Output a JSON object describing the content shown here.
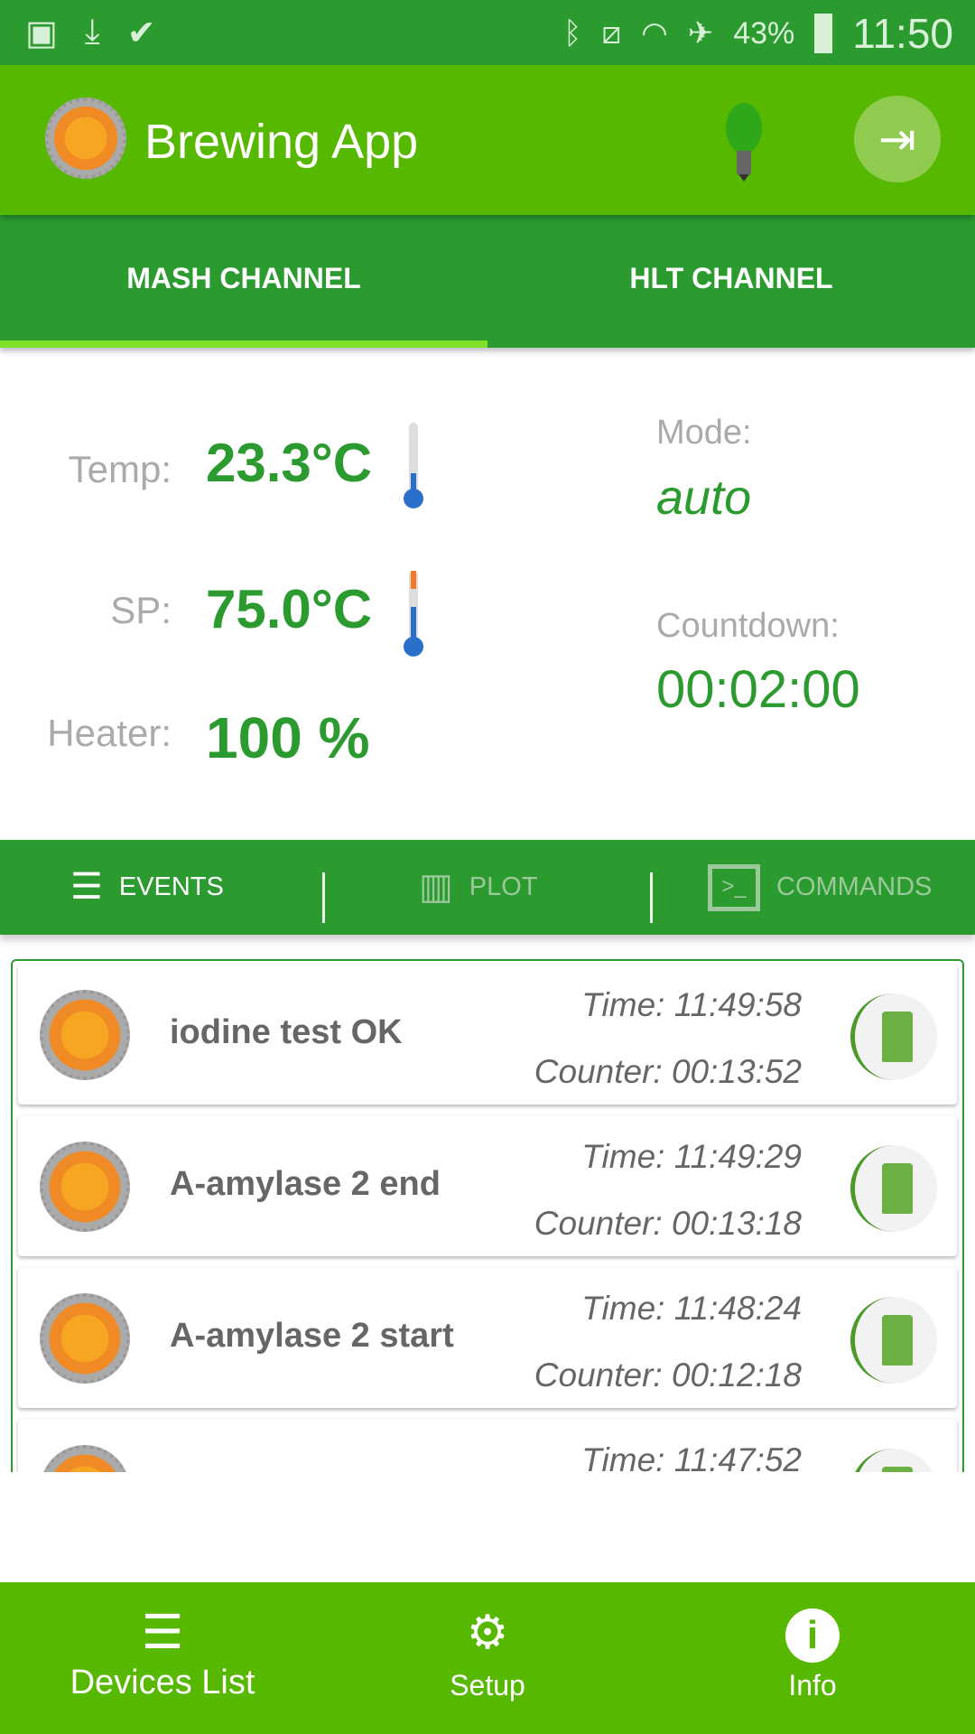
{
  "status_bar": {
    "battery": "43%",
    "time": "11:50",
    "icons": [
      "image-icon",
      "download-icon",
      "check-icon",
      "bluetooth-icon",
      "vibrate-icon",
      "wifi-icon",
      "airplane-icon",
      "battery-charging-icon"
    ]
  },
  "app_bar": {
    "title": "Brewing App",
    "icons": [
      "logo-icon",
      "lightbulb-icon",
      "exit-icon"
    ]
  },
  "tabs": [
    {
      "label": "MASH CHANNEL",
      "selected": true
    },
    {
      "label": "HLT CHANNEL",
      "selected": false
    }
  ],
  "channel": {
    "temp_label": "Temp:",
    "temp_value": "23.3°C",
    "sp_label": "SP:",
    "sp_value": "75.0°C",
    "heater_label": "Heater:",
    "heater_value": "100 %",
    "mode_label": "Mode:",
    "mode_value": "auto",
    "countdown_label": "Countdown:",
    "countdown_value": "00:02:00"
  },
  "subtabs": [
    {
      "label": "EVENTS",
      "icon": "checklist-icon",
      "selected": true
    },
    {
      "label": "PLOT",
      "icon": "chart-icon"
    },
    {
      "label": "COMMANDS",
      "icon": "terminal-icon"
    }
  ],
  "events": [
    {
      "name": "iodine test OK",
      "time": "Time: 11:49:58",
      "counter": "Counter: 00:13:52"
    },
    {
      "name": "A-amylase 2 end",
      "time": "Time: 11:49:29",
      "counter": "Counter: 00:13:18"
    },
    {
      "name": "A-amylase 2 start",
      "time": "Time: 11:48:24",
      "counter": "Counter: 00:12:18"
    },
    {
      "name": "",
      "time": "Time: 11:47:52",
      "counter": ""
    }
  ],
  "bottom_nav": [
    {
      "label": "Devices List",
      "icon": "list-icon"
    },
    {
      "label": "Setup",
      "icon": "gear-icon"
    },
    {
      "label": "Info",
      "icon": "info-icon"
    }
  ],
  "colors": {
    "primary": "#57b800",
    "dark": "#2b9b2f",
    "indicator": "#7ee02a"
  }
}
